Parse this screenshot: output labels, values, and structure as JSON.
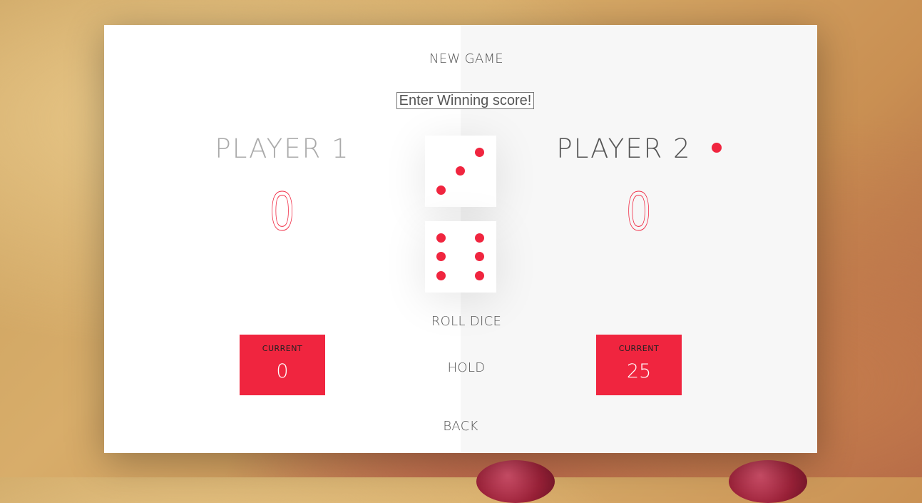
{
  "buttons": {
    "new_game": "NEW GAME",
    "roll_dice": "ROLL DICE",
    "hold": "HOLD",
    "back": "BACK"
  },
  "winning_score": {
    "placeholder": "Enter Winning score!",
    "value": ""
  },
  "players": [
    {
      "name": "PLAYER 1",
      "score": "0",
      "current_label": "CURRENT",
      "current": "0",
      "active": false
    },
    {
      "name": "PLAYER 2",
      "score": "0",
      "current_label": "CURRENT",
      "current": "25",
      "active": true
    }
  ],
  "dice": [
    {
      "face": 3
    },
    {
      "face": 6
    }
  ],
  "colors": {
    "accent": "#f0253f",
    "text": "#555555"
  }
}
